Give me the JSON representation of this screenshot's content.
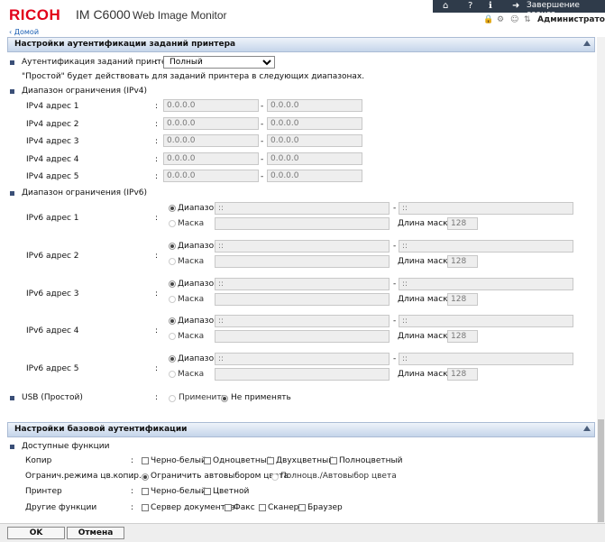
{
  "header": {
    "brand": "RICOH",
    "model": "IM C6000",
    "product": "Web Image Monitor",
    "logout_label": "Завершение сеанса",
    "user_label": "Администратор",
    "home_link": "Домой"
  },
  "print_auth": {
    "title": "Настройки аутентификации заданий принтера",
    "auth_label": "Аутентификация заданий принтера",
    "auth_value": "Полный",
    "auth_options": [
      "Полный"
    ],
    "note": "\"Простой\" будет действовать для заданий принтера в следующих диапазонах.",
    "ipv4_title": "Диапазон ограничения (IPv4)",
    "ipv4_rows": [
      {
        "label": "IPv4 адрес 1",
        "from": "0.0.0.0",
        "to": "0.0.0.0"
      },
      {
        "label": "IPv4 адрес 2",
        "from": "0.0.0.0",
        "to": "0.0.0.0"
      },
      {
        "label": "IPv4 адрес 3",
        "from": "0.0.0.0",
        "to": "0.0.0.0"
      },
      {
        "label": "IPv4 адрес 4",
        "from": "0.0.0.0",
        "to": "0.0.0.0"
      },
      {
        "label": "IPv4 адрес 5",
        "from": "0.0.0.0",
        "to": "0.0.0.0"
      }
    ],
    "ipv6_title": "Диапазон ограничения (IPv6)",
    "ipv6_range_label": "Диапазон",
    "ipv6_mask_label": "Маска",
    "ipv6_mask_len_label": "Длина маски",
    "ipv6_rows": [
      {
        "label": "IPv6 адрес 1",
        "from": "::",
        "to": "::",
        "mask": "",
        "mask_len": "128"
      },
      {
        "label": "IPv6 адрес 2",
        "from": "::",
        "to": "::",
        "mask": "",
        "mask_len": "128"
      },
      {
        "label": "IPv6 адрес 3",
        "from": "::",
        "to": "::",
        "mask": "",
        "mask_len": "128"
      },
      {
        "label": "IPv6 адрес 4",
        "from": "::",
        "to": "::",
        "mask": "",
        "mask_len": "128"
      },
      {
        "label": "IPv6 адрес 5",
        "from": "::",
        "to": "::",
        "mask": "",
        "mask_len": "128"
      }
    ],
    "usb_label": "USB (Простой)",
    "usb_apply": "Применить",
    "usb_not_apply": "Не применять"
  },
  "basic_auth": {
    "title": "Настройки базовой аутентификации",
    "functions_title": "Доступные функции",
    "copier_label": "Копир",
    "copier_opts": [
      "Черно-белый",
      "Одноцветный",
      "Двухцветный",
      "Полноцветный"
    ],
    "color_limit_label": "Огранич.режима цв.копир.",
    "color_limit_opt1": "Ограничить автовыбором цвета",
    "color_limit_opt2": "Полноцв./Автовыбор цвета",
    "printer_label": "Принтер",
    "printer_opts": [
      "Черно-белый",
      "Цветной"
    ],
    "other_label": "Другие функции",
    "other_opts": [
      "Сервер документов",
      "Факс",
      "Сканер",
      "Браузер"
    ]
  },
  "footer": {
    "ok": "OK",
    "cancel": "Отмена"
  }
}
